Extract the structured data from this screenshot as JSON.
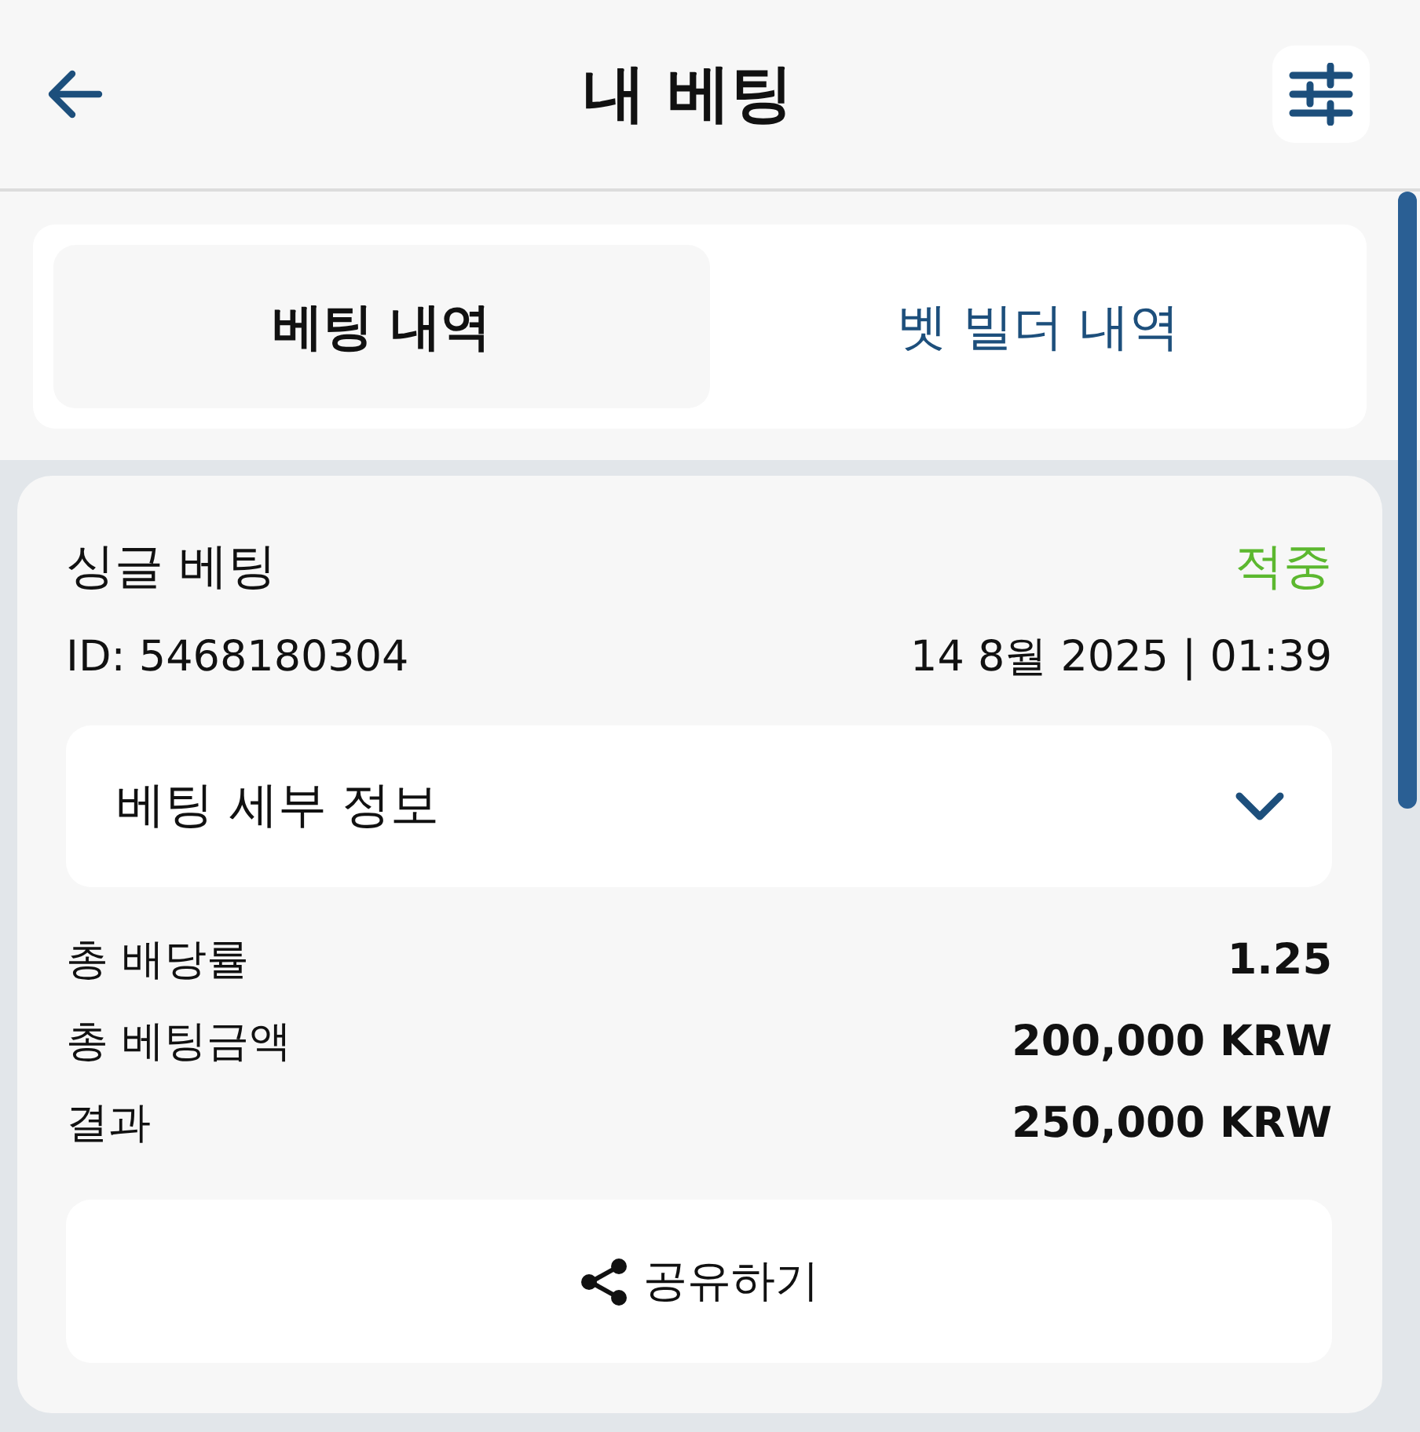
{
  "header": {
    "title": "내 베팅"
  },
  "tabs": [
    {
      "label": "베팅 내역",
      "selected": true
    },
    {
      "label": "벳 빌더 내역",
      "selected": false
    }
  ],
  "bet": {
    "type": "싱글 베팅",
    "status": "적중",
    "id": "ID: 5468180304",
    "date": "14 8월 2025 | 01:39"
  },
  "details": {
    "label": "베팅 세부 정보",
    "expanded": false
  },
  "summary": [
    {
      "label": "총 배당률",
      "value": "1.25"
    },
    {
      "label": "총 베팅금액",
      "value": "200,000 KRW"
    },
    {
      "label": "결과",
      "value": "250,000 KRW"
    }
  ],
  "share_button": {
    "label": "공유하기"
  }
}
